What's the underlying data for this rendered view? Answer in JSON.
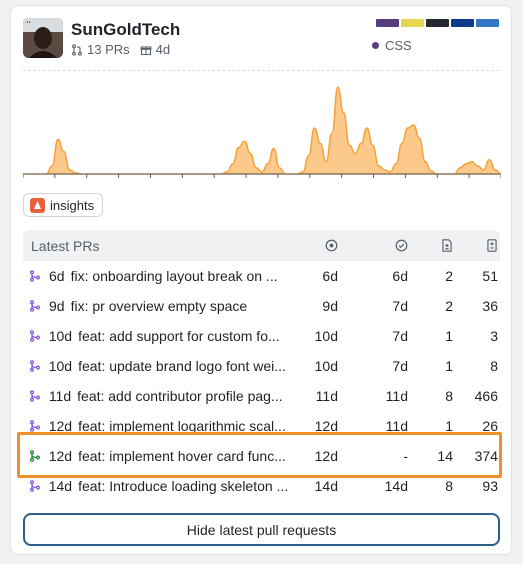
{
  "user": {
    "name": "SunGoldTech",
    "pr_count": "13 PRs",
    "age": "4d"
  },
  "languages": {
    "primary": "CSS",
    "colors": [
      "#563d7c",
      "#e8d64f",
      "#24292f",
      "#0f3b8c",
      "#3477c6"
    ]
  },
  "chart_data": {
    "type": "area",
    "values": [
      0,
      0,
      0,
      0,
      0,
      8,
      34,
      22,
      4,
      1,
      0,
      0,
      0,
      0,
      0,
      0,
      0,
      0,
      0,
      0,
      0,
      0,
      0,
      0,
      0,
      0,
      0,
      0,
      0,
      0,
      0,
      0,
      0,
      0,
      0,
      2,
      10,
      26,
      32,
      20,
      6,
      2,
      10,
      25,
      6,
      0,
      0,
      0,
      2,
      18,
      45,
      30,
      12,
      40,
      85,
      60,
      28,
      20,
      30,
      45,
      28,
      8,
      4,
      2,
      10,
      30,
      45,
      48,
      35,
      12,
      3,
      0,
      0,
      0,
      0,
      6,
      10,
      12,
      8,
      4,
      14,
      4,
      0
    ],
    "color": "#f7a23a"
  },
  "badge": {
    "label": "insights"
  },
  "table": {
    "header": "Latest PRs",
    "rows": [
      {
        "age": "6d",
        "title": "fix: onboarding layout break on ...",
        "open": "6d",
        "review": "6d",
        "files": "2",
        "changes": "51",
        "state": "merged"
      },
      {
        "age": "9d",
        "title": "fix: pr overview empty space",
        "open": "9d",
        "review": "7d",
        "files": "2",
        "changes": "36",
        "state": "merged"
      },
      {
        "age": "10d",
        "title": "feat: add support for custom fo...",
        "open": "10d",
        "review": "7d",
        "files": "1",
        "changes": "3",
        "state": "merged"
      },
      {
        "age": "10d",
        "title": "feat: update brand logo font wei...",
        "open": "10d",
        "review": "7d",
        "files": "1",
        "changes": "8",
        "state": "merged"
      },
      {
        "age": "11d",
        "title": "feat: add contributor profile pag...",
        "open": "11d",
        "review": "11d",
        "files": "8",
        "changes": "466",
        "state": "merged"
      },
      {
        "age": "12d",
        "title": "feat: implement logarithmic scal...",
        "open": "12d",
        "review": "11d",
        "files": "1",
        "changes": "26",
        "state": "merged"
      },
      {
        "age": "12d",
        "title": "feat: implement hover card func...",
        "open": "12d",
        "review": "-",
        "files": "14",
        "changes": "374",
        "state": "open"
      },
      {
        "age": "14d",
        "title": "feat: Introduce loading skeleton ...",
        "open": "14d",
        "review": "14d",
        "files": "8",
        "changes": "93",
        "state": "merged"
      }
    ]
  },
  "hide_button": "Hide latest pull requests"
}
